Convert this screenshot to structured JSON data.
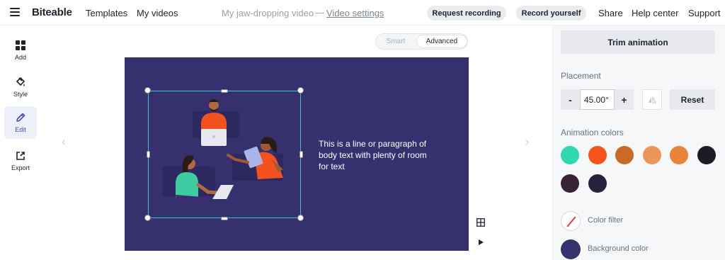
{
  "header": {
    "brand": "Biteable",
    "nav": [
      {
        "label": "Templates"
      },
      {
        "label": "My videos"
      }
    ],
    "doc_title": "My jaw-dropping video",
    "doc_separator": "—",
    "video_settings_label": "Video settings",
    "request_recording_label": "Request recording",
    "record_yourself_label": "Record yourself",
    "share_label": "Share",
    "help_center_label": "Help center",
    "support_label": "Support"
  },
  "sidebar": {
    "items": [
      {
        "label": "Add",
        "icon": "grid-icon"
      },
      {
        "label": "Style",
        "icon": "paint-bucket-icon"
      },
      {
        "label": "Edit",
        "icon": "pencil-icon",
        "active": true
      },
      {
        "label": "Export",
        "icon": "export-icon"
      }
    ]
  },
  "canvas": {
    "mode_toggle": {
      "smart": "Smart",
      "advanced": "Advanced",
      "selected": "Advanced"
    },
    "body_text": "This is a line or paragraph of body text with plenty of room for text",
    "prev_arrow": "‹",
    "next_arrow": "›",
    "stage_color": "#36306f",
    "selection_color": "#35c7d3"
  },
  "panel": {
    "trim_label": "Trim animation",
    "placement_label": "Placement",
    "placement_value": "45.00°",
    "minus_label": "-",
    "plus_label": "+",
    "reset_label": "Reset",
    "animation_colors_label": "Animation colors",
    "colors": [
      "#2ed8b1",
      "#f6541c",
      "#c96b27",
      "#ec9559",
      "#e8843a",
      "#1f1b24",
      "#3a2337",
      "#25223b"
    ],
    "color_filter_label": "Color filter",
    "background_color_label": "Background color",
    "background_color": "#36306f"
  }
}
